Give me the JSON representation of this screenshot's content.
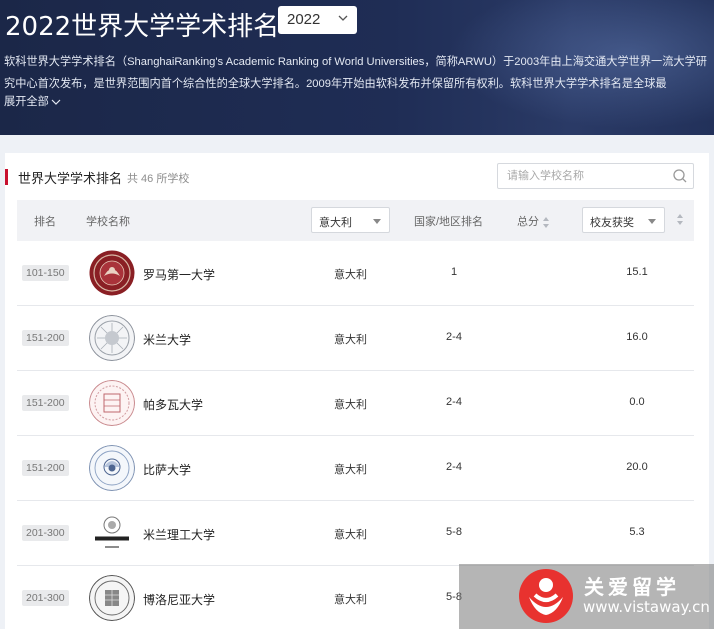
{
  "banner": {
    "title": "2022世界大学学术排名",
    "year_selected": "2022",
    "description": "软科世界大学学术排名（ShanghaiRanking's Academic Ranking of World Universities，简称ARWU）于2003年由上海交通大学世界一流大学研究中心首次发布，是世界范围内首个综合性的全球大学排名。2009年开始由软科发布并保留所有权利。软科世界大学学术排名是全球最",
    "expand_label": "展开全部"
  },
  "card": {
    "title": "世界大学学术排名",
    "count": "共 46 所学校",
    "search_placeholder": "请输入学校名称"
  },
  "table": {
    "headers": {
      "rank": "排名",
      "name": "学校名称",
      "country_filter": "意大利",
      "region_rank": "国家/地区排名",
      "total": "总分",
      "indicator": "校友获奖"
    },
    "rows": [
      {
        "rank": "101-150",
        "name": "罗马第一大学",
        "country": "意大利",
        "region_rank": "1",
        "alumni": "15.1",
        "logo": "seal-red"
      },
      {
        "rank": "151-200",
        "name": "米兰大学",
        "country": "意大利",
        "region_rank": "2-4",
        "alumni": "16.0",
        "logo": "seal-gray"
      },
      {
        "rank": "151-200",
        "name": "帕多瓦大学",
        "country": "意大利",
        "region_rank": "2-4",
        "alumni": "0.0",
        "logo": "seal-rose"
      },
      {
        "rank": "151-200",
        "name": "比萨大学",
        "country": "意大利",
        "region_rank": "2-4",
        "alumni": "20.0",
        "logo": "seal-blue"
      },
      {
        "rank": "201-300",
        "name": "米兰理工大学",
        "country": "意大利",
        "region_rank": "5-8",
        "alumni": "5.3",
        "logo": "seal-politecnico"
      },
      {
        "rank": "201-300",
        "name": "博洛尼亚大学",
        "country": "意大利",
        "region_rank": "5-8",
        "alumni": "",
        "logo": "seal-dark"
      }
    ]
  },
  "watermark": {
    "name": "关爱留学",
    "url": "www.vistaway.cn"
  },
  "colors": {
    "banner_bg": "#1f2d55",
    "accent": "#c8102e",
    "header_bg": "#f1f2f5"
  }
}
